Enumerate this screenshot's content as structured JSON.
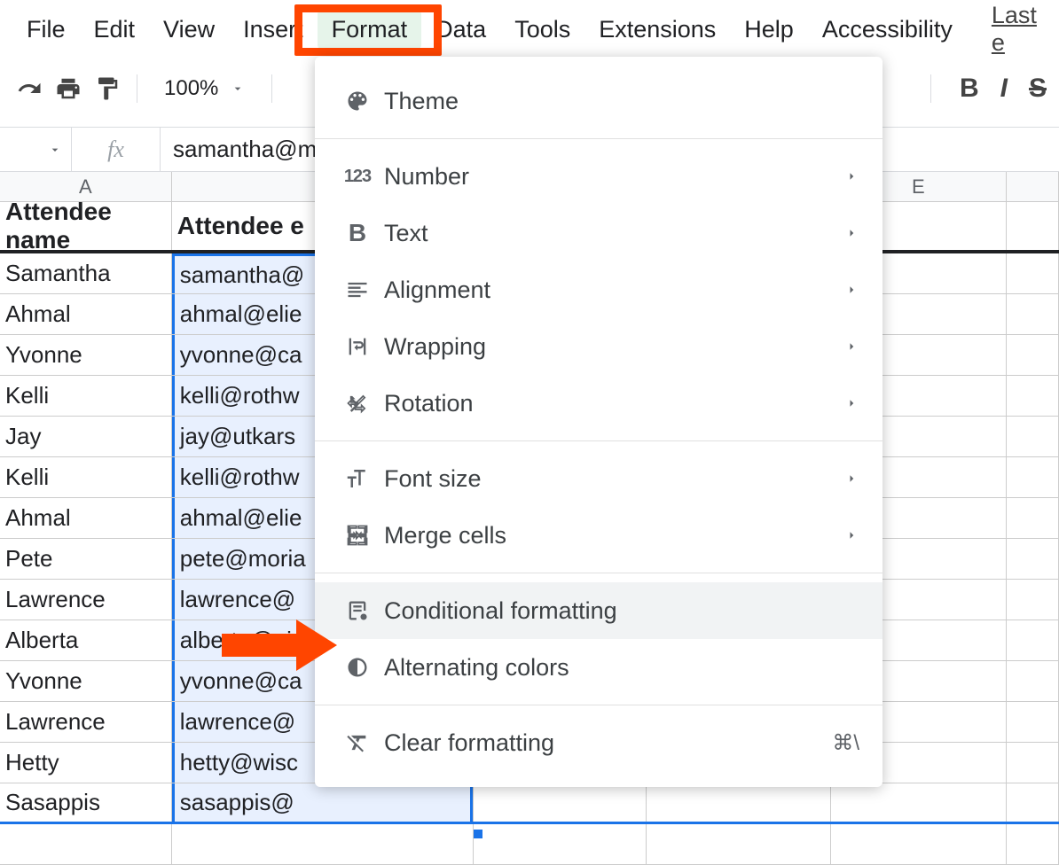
{
  "menubar": {
    "file": "File",
    "edit": "Edit",
    "view": "View",
    "insert": "Insert",
    "format": "Format",
    "data": "Data",
    "tools": "Tools",
    "extensions": "Extensions",
    "help": "Help",
    "accessibility": "Accessibility",
    "last_edit": "Last e"
  },
  "toolbar": {
    "zoom": "100%",
    "bold": "B",
    "italic": "I",
    "strike": "S"
  },
  "formula_bar": {
    "fx": "fx",
    "value": "samantha@m"
  },
  "columns": {
    "a": "A",
    "e": "E"
  },
  "headers": {
    "a": "Attendee name",
    "b": "Attendee e"
  },
  "rows": [
    {
      "a": "Samantha",
      "b": "samantha@"
    },
    {
      "a": "Ahmal",
      "b": "ahmal@elie"
    },
    {
      "a": "Yvonne",
      "b": "yvonne@ca"
    },
    {
      "a": "Kelli",
      "b": "kelli@rothw"
    },
    {
      "a": "Jay",
      "b": "jay@utkars"
    },
    {
      "a": "Kelli",
      "b": "kelli@rothw"
    },
    {
      "a": "Ahmal",
      "b": "ahmal@elie"
    },
    {
      "a": "Pete",
      "b": "pete@moria"
    },
    {
      "a": "Lawrence",
      "b": "lawrence@"
    },
    {
      "a": "Alberta",
      "b": "alberta@pi"
    },
    {
      "a": "Yvonne",
      "b": "yvonne@ca"
    },
    {
      "a": "Lawrence",
      "b": "lawrence@"
    },
    {
      "a": "Hetty",
      "b": "hetty@wisc"
    },
    {
      "a": "Sasappis",
      "b": "sasappis@"
    }
  ],
  "dropdown": {
    "theme": "Theme",
    "number": "Number",
    "text": "Text",
    "alignment": "Alignment",
    "wrapping": "Wrapping",
    "rotation": "Rotation",
    "font_size": "Font size",
    "merge_cells": "Merge cells",
    "conditional_formatting": "Conditional formatting",
    "alternating_colors": "Alternating colors",
    "clear_formatting": "Clear formatting",
    "clear_shortcut": "⌘\\"
  }
}
